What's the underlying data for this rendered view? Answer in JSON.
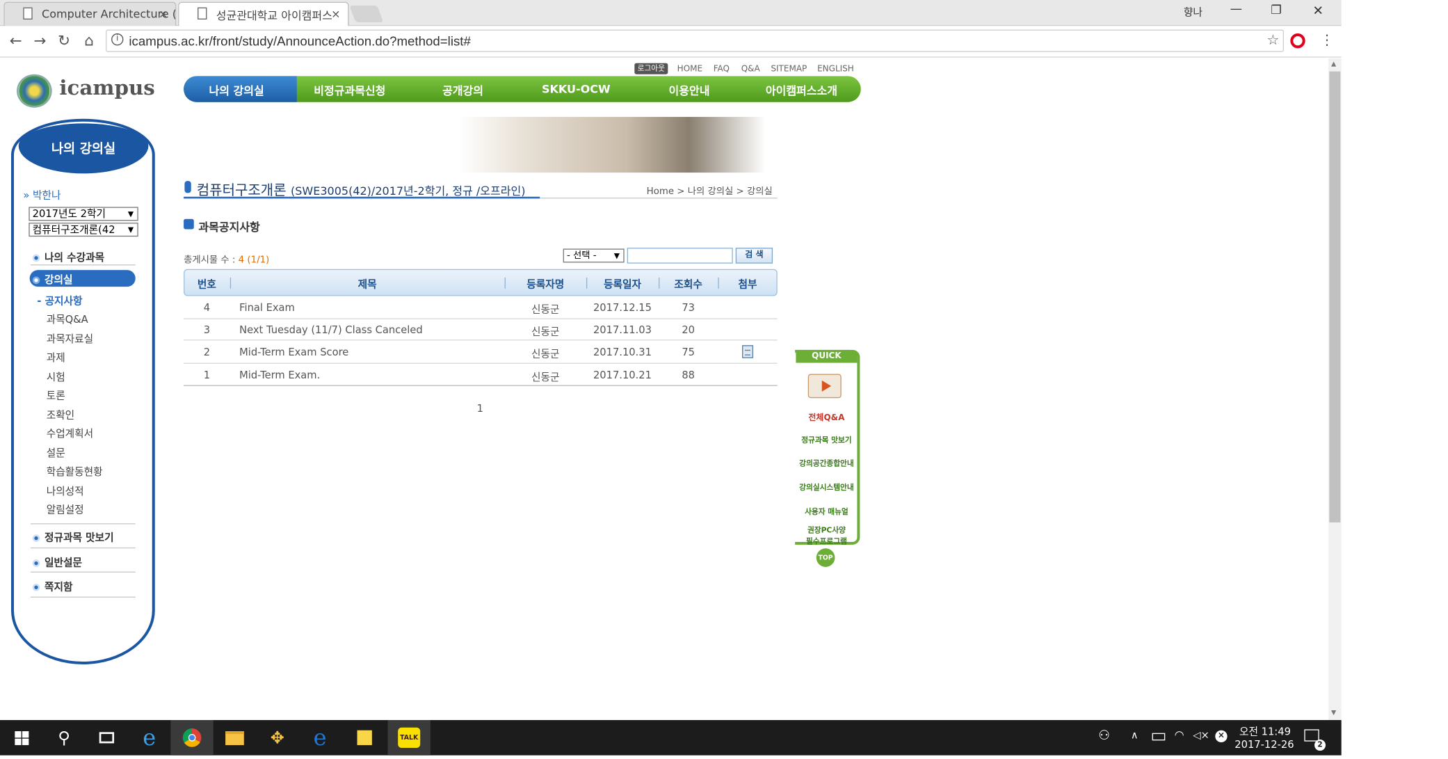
{
  "browser": {
    "tabs": [
      {
        "title": "Computer Architecture (",
        "close": "×"
      },
      {
        "title": "성균관대학교 아이캠퍼스",
        "close": "×"
      }
    ],
    "user_label": "향나",
    "window_controls": {
      "minimize": "—",
      "restore": "❐",
      "close": "✕"
    },
    "url": "icampus.ac.kr/front/study/AnnounceAction.do?method=list#"
  },
  "site": {
    "logo_text": "icampus",
    "top_links": [
      "로그아웃",
      "HOME",
      "FAQ",
      "Q&A",
      "SITEMAP",
      "ENGLISH"
    ],
    "gnb": [
      "나의 강의실",
      "비정규과목신청",
      "공개강의",
      "SKKU-OCW",
      "이용안내",
      "아이캠퍼스소개"
    ]
  },
  "sidebar": {
    "title": "나의 강의실",
    "user": "박한나",
    "semester_select": "2017년도 2학기",
    "course_select": "컴퓨터구조개론(42",
    "main_items": [
      "나의 수강과목",
      "강의실"
    ],
    "sub_items": [
      "공지사항",
      "과목Q&A",
      "과목자료실",
      "과제",
      "시험",
      "토론",
      "조확인",
      "수업계획서",
      "설문",
      "학습활동현황",
      "나의성적",
      "알림설정"
    ],
    "extra_items": [
      "정규과목 맛보기",
      "일반설문",
      "쪽지함"
    ]
  },
  "content": {
    "course_title": "컴퓨터구조개론",
    "course_meta": "(SWE3005(42)/2017년-2학기, 정규 /오프라인)",
    "breadcrumb": "Home > 나의 강의실 > 강의실",
    "section_title": "과목공지사항",
    "total_label": "총게시물 수 : ",
    "total_value": "4 (1/1)",
    "search_select": "- 선택 -",
    "search_button": "검 색",
    "columns": [
      "번호",
      "제목",
      "등록자명",
      "등록일자",
      "조회수",
      "첨부"
    ],
    "rows": [
      {
        "no": "4",
        "title": "Final Exam",
        "author": "신동군",
        "date": "2017.12.15",
        "views": "73",
        "attach": false
      },
      {
        "no": "3",
        "title": "Next Tuesday (11/7) Class Canceled",
        "author": "신동군",
        "date": "2017.11.03",
        "views": "20",
        "attach": false
      },
      {
        "no": "2",
        "title": "Mid-Term Exam Score",
        "author": "신동군",
        "date": "2017.10.31",
        "views": "75",
        "attach": true
      },
      {
        "no": "1",
        "title": "Mid-Term Exam.",
        "author": "신동군",
        "date": "2017.10.21",
        "views": "88",
        "attach": false
      }
    ],
    "page_number": "1"
  },
  "quick": {
    "title": "QUICK",
    "items": [
      "전체Q&A",
      "정규과목 맛보기",
      "강의공간종합안내",
      "강의실시스템안내",
      "사용자 매뉴얼",
      "권장PC사양",
      "필수프로그램"
    ],
    "top": "TOP"
  },
  "taskbar": {
    "time": "오전 11:49",
    "date": "2017-12-26",
    "notification_count": "2"
  }
}
